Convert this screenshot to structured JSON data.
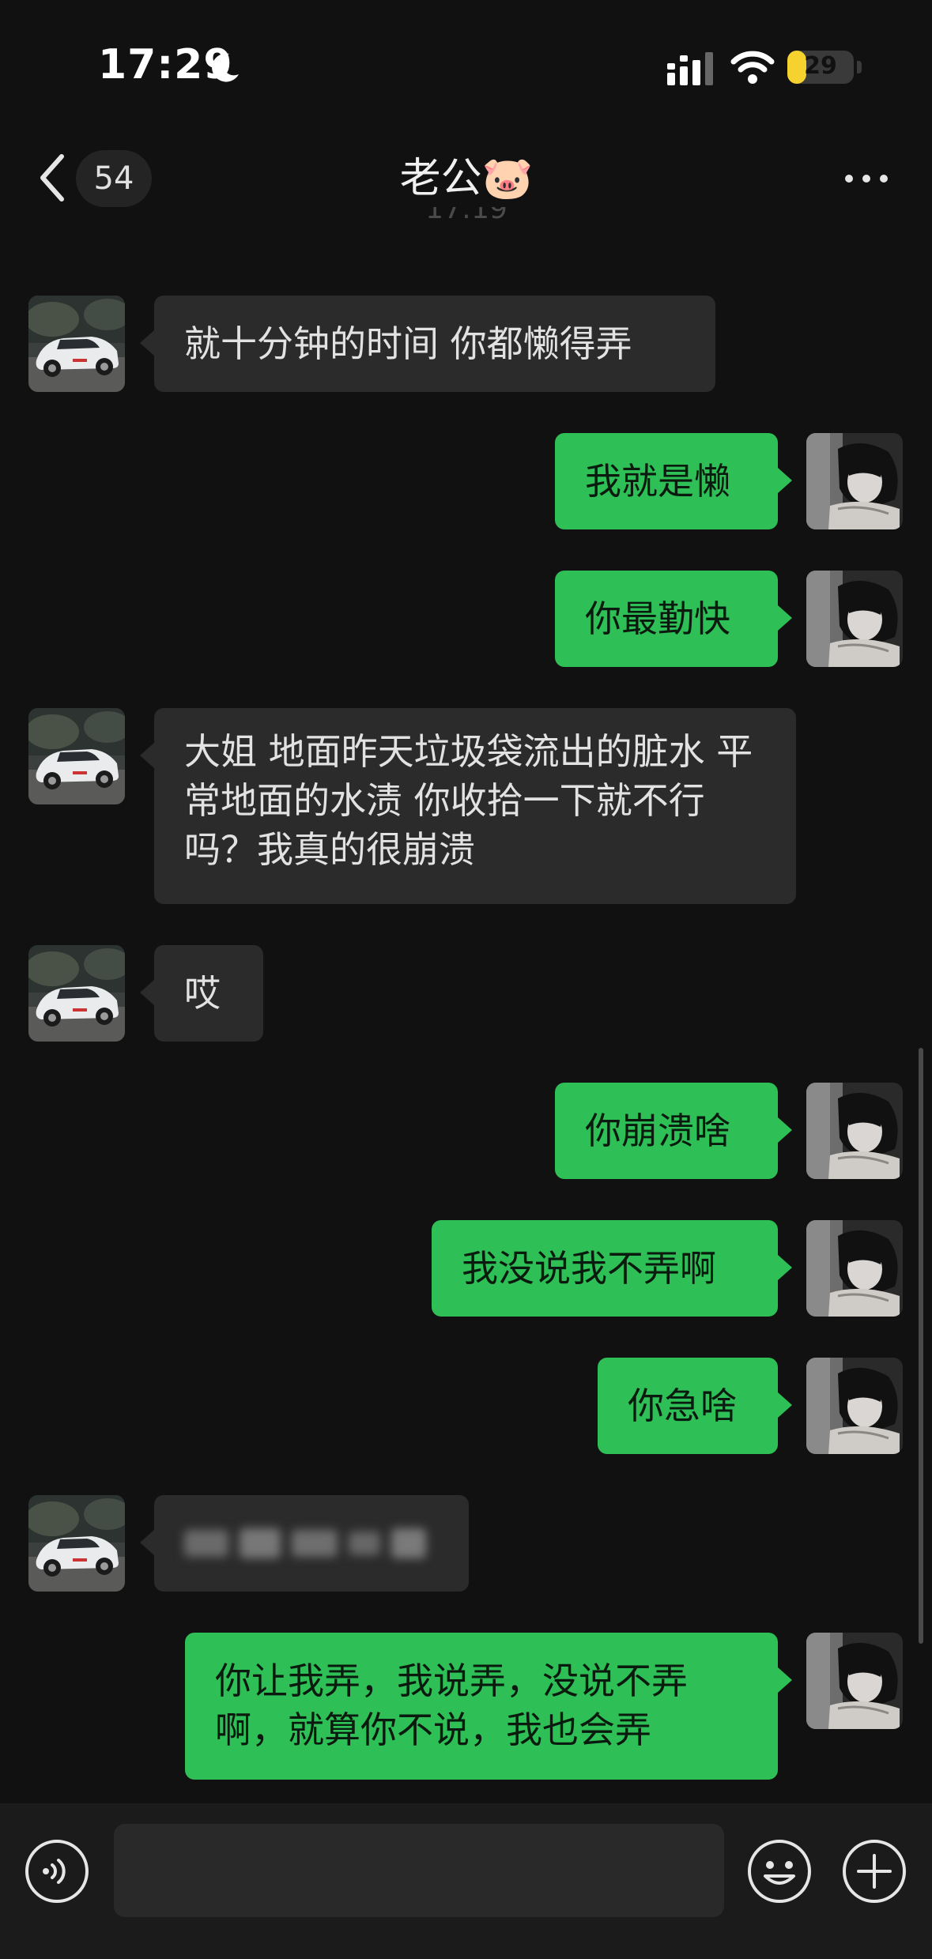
{
  "status_bar": {
    "time": "17:29",
    "battery": "29",
    "battery_level": 0.29
  },
  "nav": {
    "unread_count": "54",
    "title": "老公🐷"
  },
  "timestamp": "17:19",
  "messages": [
    {
      "from": "other",
      "text": "就十分钟的时间 你都懒得弄"
    },
    {
      "from": "me",
      "text": "我就是懒"
    },
    {
      "from": "me",
      "text": "你最勤快"
    },
    {
      "from": "other",
      "text": "大姐 地面昨天垃圾袋流出的脏水 平常地面的水渍 你收拾一下就不行吗？我真的很崩溃"
    },
    {
      "from": "other",
      "text": "哎"
    },
    {
      "from": "me",
      "text": "你崩溃啥"
    },
    {
      "from": "me",
      "text": "我没说我不弄啊"
    },
    {
      "from": "me",
      "text": "你急啥"
    },
    {
      "from": "other",
      "text": "",
      "blurred": true
    },
    {
      "from": "me",
      "text": "你让我弄，我说弄，没说不弄啊，就算你不说，我也会弄"
    }
  ],
  "input": {
    "value": ""
  },
  "icons": {
    "back": "chevron-left-icon",
    "more": "more-dots-icon",
    "voice": "voice-icon",
    "emoji": "emoji-icon",
    "plus": "plus-icon"
  },
  "colors": {
    "background": "#111111",
    "bubble_other": "#2b2b2b",
    "bubble_me": "#2ec056",
    "battery": "#f5d22e"
  }
}
